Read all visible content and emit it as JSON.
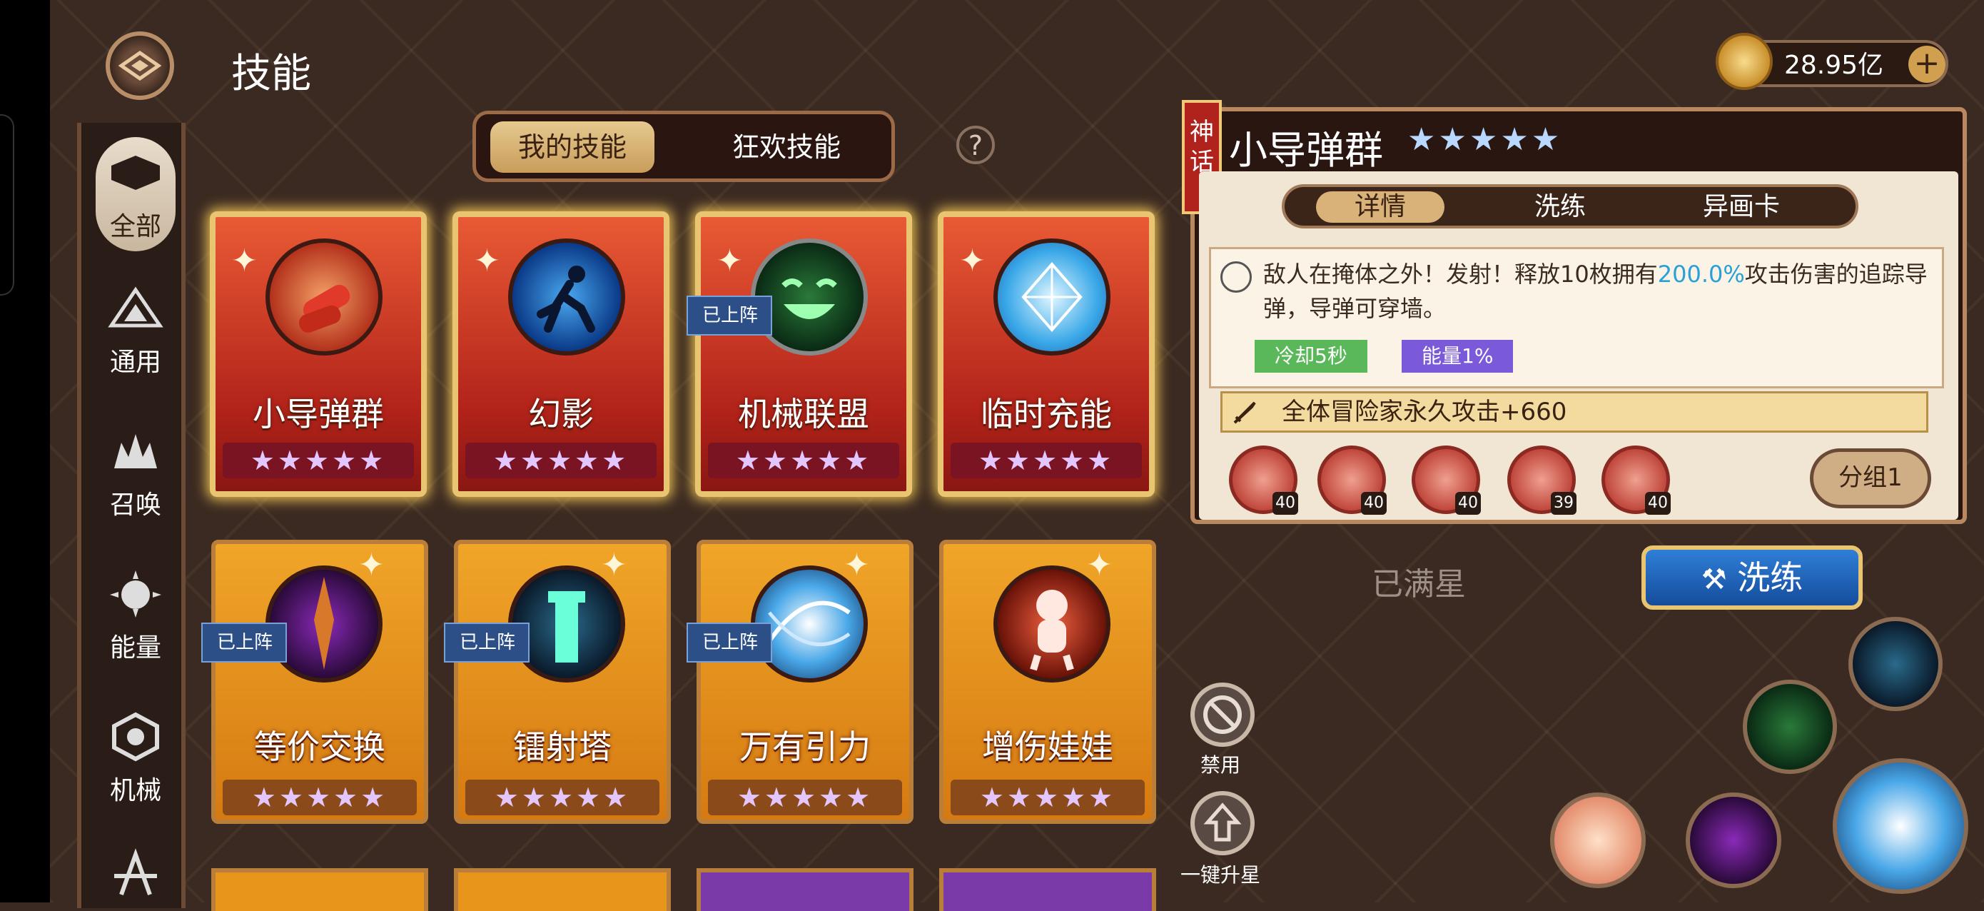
{
  "header": {
    "title": "技能"
  },
  "currency": {
    "amount": "28.95亿",
    "add": "+"
  },
  "sidebar": {
    "items": [
      {
        "label": "全部",
        "icon": "all-icon"
      },
      {
        "label": "通用",
        "icon": "general-icon"
      },
      {
        "label": "召唤",
        "icon": "summon-icon"
      },
      {
        "label": "能量",
        "icon": "energy-icon"
      },
      {
        "label": "机械",
        "icon": "mech-icon"
      }
    ]
  },
  "tabs": {
    "my_skills": "我的技能",
    "carnival_skills": "狂欢技能",
    "help": "?"
  },
  "cards": [
    {
      "name": "小导弹群",
      "stars": "★★★★★",
      "deployed": ""
    },
    {
      "name": "幻影",
      "stars": "★★★★★",
      "deployed": ""
    },
    {
      "name": "机械联盟",
      "stars": "★★★★★",
      "deployed": "已上阵"
    },
    {
      "name": "临时充能",
      "stars": "★★★★★",
      "deployed": ""
    },
    {
      "name": "等价交换",
      "stars": "★★★★★",
      "deployed": "已上阵"
    },
    {
      "name": "镭射塔",
      "stars": "★★★★★",
      "deployed": "已上阵"
    },
    {
      "name": "万有引力",
      "stars": "★★★★★",
      "deployed": "已上阵"
    },
    {
      "name": "增伤娃娃",
      "stars": "★★★★★",
      "deployed": ""
    }
  ],
  "detail": {
    "rarity": "神话",
    "name": "小导弹群",
    "stars": "★★★★★",
    "subtabs": [
      "详情",
      "洗练",
      "异画卡"
    ],
    "desc_pre": "敌人在掩体之外！发射！释放10枚拥有",
    "desc_highlight": "200.0%",
    "desc_post": "攻击伤害的追踪导弹，导弹可穿墙。",
    "cooldown": "冷却5秒",
    "energy": "能量1%",
    "passive": "全体冒险家永久攻击+660",
    "runes": [
      "40",
      "40",
      "40",
      "39",
      "40"
    ],
    "group_button": "分组1"
  },
  "status": {
    "max_star": "已满星",
    "reforge": "洗练"
  },
  "actions": {
    "ban": "禁用",
    "upgrade_all": "一键升星"
  },
  "colors": {
    "accent_gold": "#e9c471",
    "highlight_blue": "#2aa0d8",
    "card_red": "#c92f22",
    "card_gold": "#e8951c"
  }
}
